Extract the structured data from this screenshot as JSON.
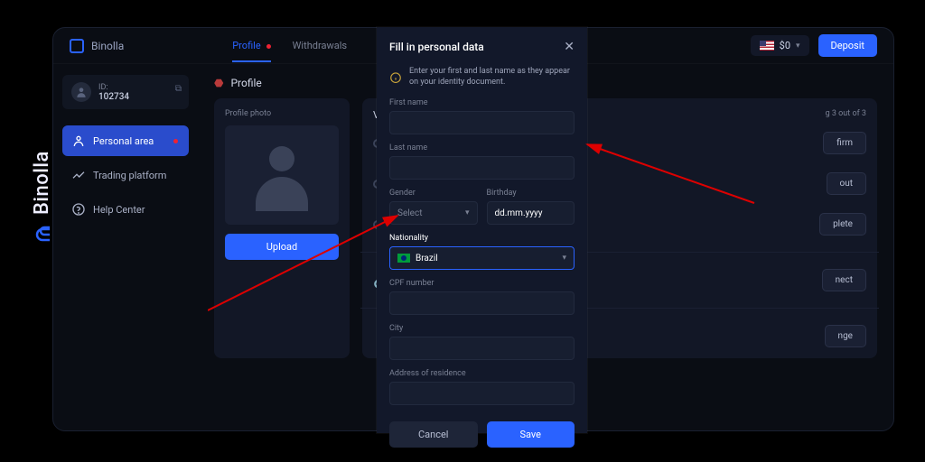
{
  "watermark": "Binolla",
  "logo": "Binolla",
  "tabs": {
    "profile": "Profile",
    "withdrawals": "Withdrawals"
  },
  "balance": "$0",
  "deposit": "Deposit",
  "user": {
    "id_label": "ID:",
    "id": "102734"
  },
  "nav": {
    "personal": "Personal area",
    "trading": "Trading platform",
    "help": "Help Center"
  },
  "section": "Profile",
  "photo": {
    "label": "Profile photo",
    "upload": "Upload"
  },
  "ver": {
    "head": "Ve",
    "remain": "g 3 out of 3",
    "btn1": "firm",
    "btn2": "out",
    "btn3": "plete",
    "btn4": "nect",
    "btn5": "nge"
  },
  "modal": {
    "title": "Fill in personal data",
    "notice": "Enter your first and last name as they appear on your identity document.",
    "first": "First name",
    "last": "Last name",
    "gender": "Gender",
    "gender_sel": "Select",
    "birthday": "Birthday",
    "birthday_ph": "dd.mm.yyyy",
    "nationality": "Nationality",
    "nat_val": "Brazil",
    "cpf": "CPF number",
    "city": "City",
    "addr": "Address of residence",
    "cancel": "Cancel",
    "save": "Save"
  }
}
